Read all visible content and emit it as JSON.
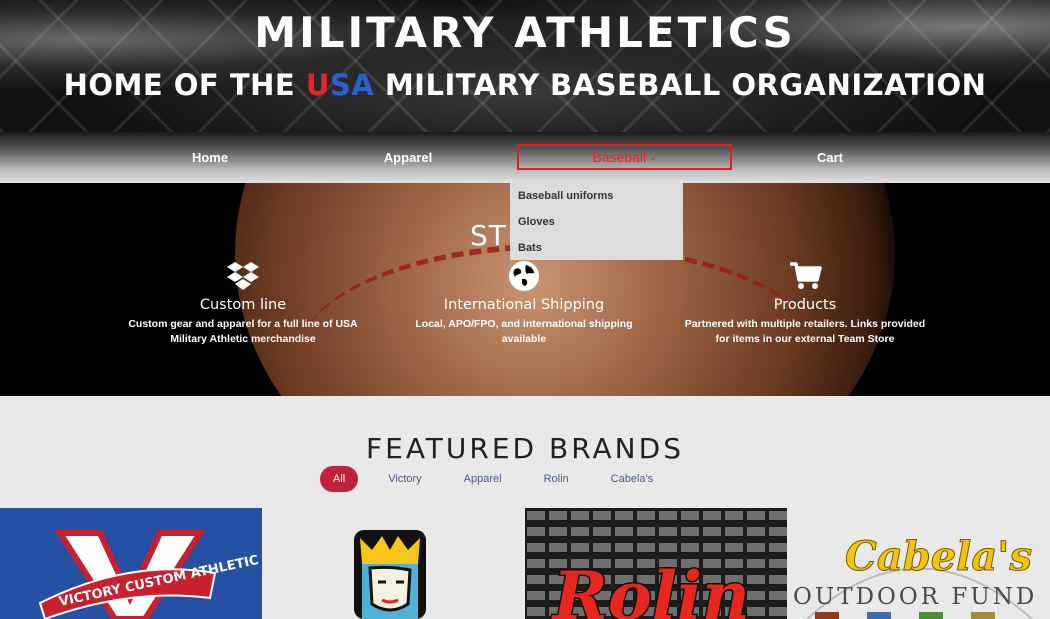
{
  "hero": {
    "title": "MILITARY ATHLETICS",
    "subtitle_pre": "HOME OF THE ",
    "subtitle_u": "U",
    "subtitle_s": "S",
    "subtitle_a": "A",
    "subtitle_post": " MILITARY BASEBALL ORGANIZATION"
  },
  "nav": {
    "items": [
      {
        "label": "Home"
      },
      {
        "label": "Apparel"
      },
      {
        "label": "Baseball"
      },
      {
        "label": "Cart"
      }
    ],
    "active": "Baseball"
  },
  "dropdown": {
    "items": [
      "Baseball uniforms",
      "Gloves",
      "Bats"
    ]
  },
  "banner": {
    "title_fragment": "ST",
    "features": [
      {
        "icon": "dropbox-icon",
        "title": "Custom line",
        "desc": "Custom gear and apparel for a full line of USA Military Athletic merchandise"
      },
      {
        "icon": "globe-icon",
        "title": "International Shipping",
        "desc": "Local, APO/FPO, and international shipping available"
      },
      {
        "icon": "cart-icon",
        "title": "Products",
        "desc": "Partnered with multiple retailers. Links provided for items in our external Team Store"
      }
    ]
  },
  "brands": {
    "title": "FEATURED BRANDS",
    "filters": [
      "All",
      "Victory",
      "Apparel",
      "Rolin",
      "Cabela's"
    ],
    "active_filter": "All",
    "tiles": [
      {
        "name": "Victory",
        "text": "VICTORY CUSTOM ATHLETIC"
      },
      {
        "name": "Apparel",
        "text": ""
      },
      {
        "name": "Rolin",
        "text": "Rolin"
      },
      {
        "name": "Cabela's",
        "text_top": "Cabela's",
        "text_bottom": "OUTDOOR FUND"
      }
    ]
  },
  "colors": {
    "accent_red": "#e02020",
    "filter_active": "#c0213c",
    "victory_blue": "#2650a3"
  }
}
